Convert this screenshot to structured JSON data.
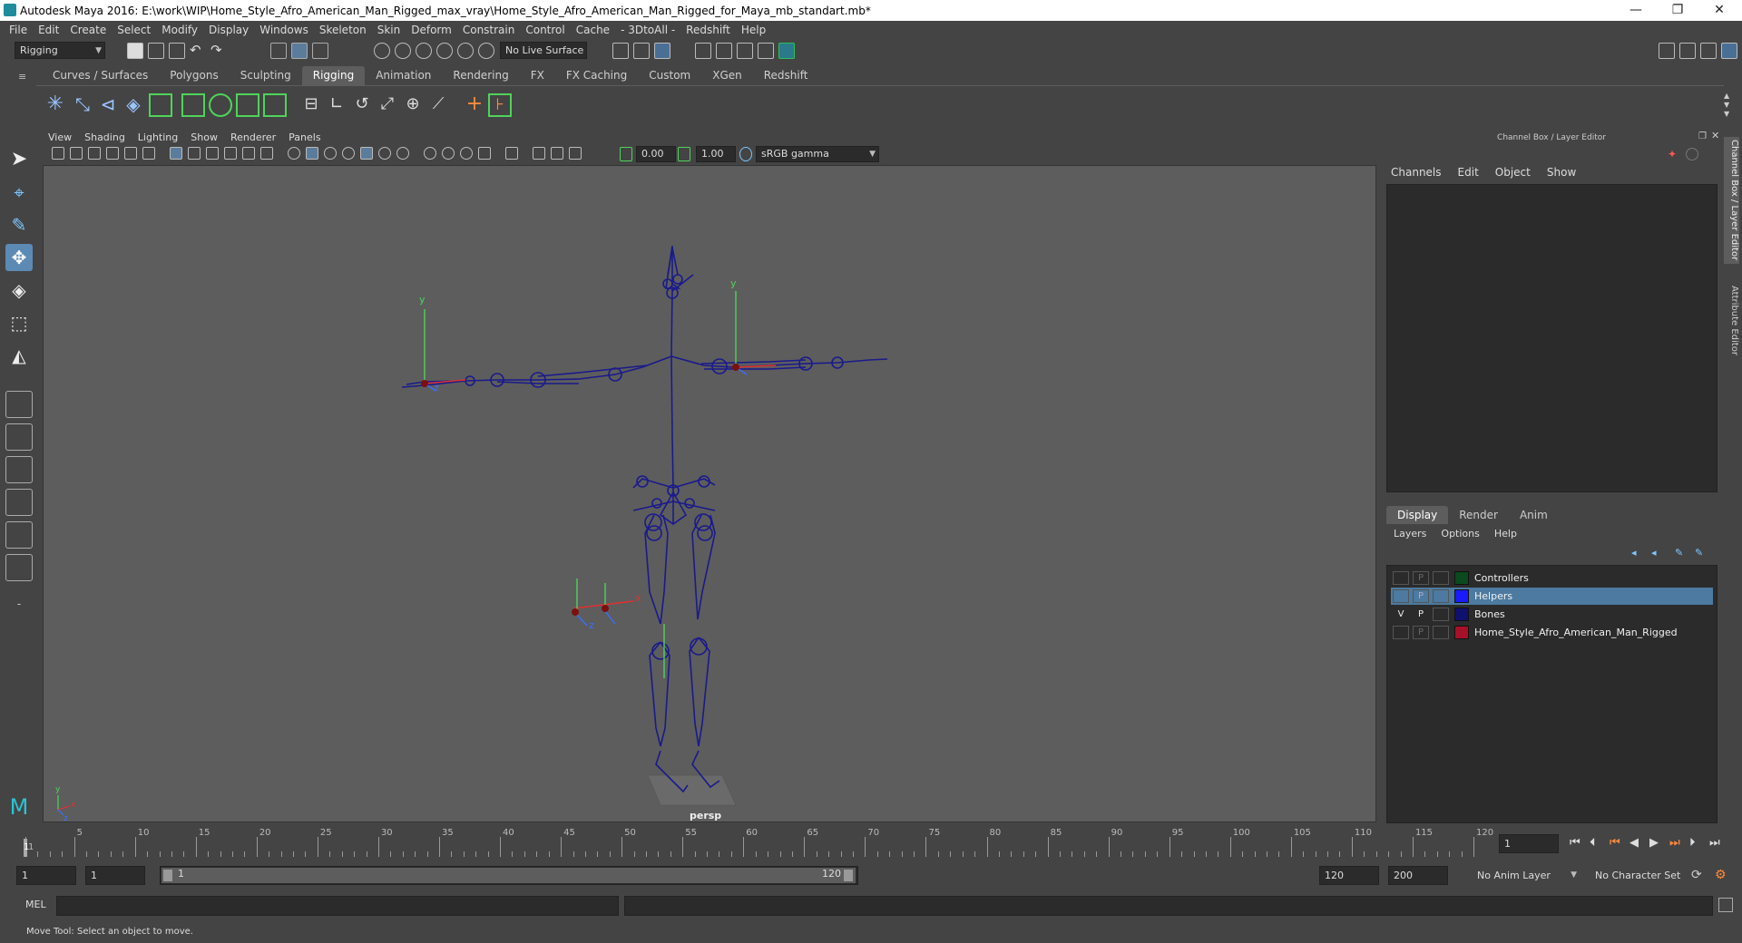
{
  "window": {
    "title": "Autodesk Maya 2016: E:\\work\\WIP\\Home_Style_Afro_American_Man_Rigged_max_vray\\Home_Style_Afro_American_Man_Rigged_for_Maya_mb_standart.mb*",
    "minimize": "—",
    "restore": "❐",
    "close": "✕"
  },
  "menubar": [
    "File",
    "Edit",
    "Create",
    "Select",
    "Modify",
    "Display",
    "Windows",
    "Skeleton",
    "Skin",
    "Deform",
    "Constrain",
    "Control",
    "Cache",
    "- 3DtoAll -",
    "Redshift",
    "Help"
  ],
  "statusline": {
    "mode": "Rigging",
    "live_surface": "No Live Surface"
  },
  "shelf": {
    "tabs": [
      "Curves / Surfaces",
      "Polygons",
      "Sculpting",
      "Rigging",
      "Animation",
      "Rendering",
      "FX",
      "FX Caching",
      "Custom",
      "XGen",
      "Redshift"
    ],
    "active_tab": "Rigging"
  },
  "viewport": {
    "menus": [
      "View",
      "Shading",
      "Lighting",
      "Show",
      "Renderer",
      "Panels"
    ],
    "exposure": "0.00",
    "gamma": "1.00",
    "color_space": "sRGB gamma",
    "camera_label": "persp"
  },
  "channel_box": {
    "header": "Channel Box / Layer Editor",
    "menus": [
      "Channels",
      "Edit",
      "Object",
      "Show"
    ]
  },
  "layer_editor": {
    "tabs": [
      "Display",
      "Render",
      "Anim"
    ],
    "active_tab": "Display",
    "menus": [
      "Layers",
      "Options",
      "Help"
    ],
    "layers": [
      {
        "v": "",
        "p": "P",
        "name": "Controllers",
        "color": "#0a4a1e",
        "selected": false
      },
      {
        "v": "",
        "p": "P",
        "name": "Helpers",
        "color": "#1a1aff",
        "selected": true
      },
      {
        "v": "V",
        "p": "P",
        "name": "Bones",
        "color": "#10106e",
        "selected": false
      },
      {
        "v": "",
        "p": "P",
        "name": "Home_Style_Afro_American_Man_Rigged",
        "color": "#a8102a",
        "selected": false
      }
    ]
  },
  "side_tabs": [
    "Channel Box / Layer Editor",
    "Attribute Editor"
  ],
  "time_slider": {
    "labels": [
      "1",
      "5",
      "10",
      "15",
      "20",
      "25",
      "30",
      "35",
      "40",
      "45",
      "50",
      "55",
      "60",
      "65",
      "70",
      "75",
      "80",
      "85",
      "90",
      "95",
      "100",
      "105",
      "110",
      "115",
      "120"
    ],
    "current_frame": "1"
  },
  "range": {
    "start": "1",
    "playback_start": "1",
    "slider_start": "1",
    "slider_end": "120",
    "playback_end": "120",
    "end": "200",
    "anim_layer": "No Anim Layer",
    "character_set": "No Character Set"
  },
  "command_line": {
    "lang": "MEL"
  },
  "help_line": "Move Tool: Select an object to move.",
  "colors": {
    "bg": "#444444",
    "viewport": "#5d5d5d",
    "skeleton": "#1a1a8c",
    "selection": "#4c7aa0"
  }
}
